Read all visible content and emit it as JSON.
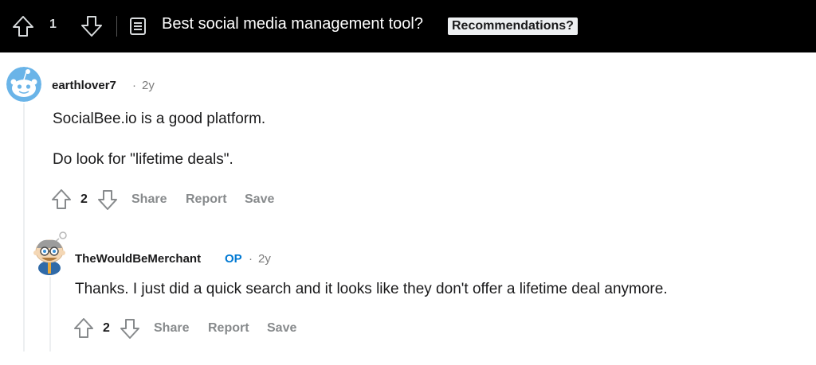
{
  "post": {
    "score": "1",
    "title": "Best social media management tool?",
    "flair": "Recommendations?"
  },
  "comments": [
    {
      "username": "earthlover7",
      "separator": "·",
      "age": "2y",
      "paragraphs": [
        "SocialBee.io is a good platform.",
        "Do look for \"lifetime deals\"."
      ],
      "score": "2",
      "actions": {
        "share": "Share",
        "report": "Report",
        "save": "Save"
      }
    },
    {
      "username": "TheWouldBeMerchant",
      "badge": "OP",
      "separator": "·",
      "age": "2y",
      "paragraphs": [
        "Thanks. I just did a quick search and it looks like they don't offer a lifetime deal anymore."
      ],
      "score": "2",
      "actions": {
        "share": "Share",
        "report": "Report",
        "save": "Save"
      }
    }
  ],
  "icons": {
    "upvote": "arrow-up-outline-icon",
    "downvote": "arrow-down-outline-icon",
    "post": "text-post-icon"
  },
  "colors": {
    "topbar_bg": "#000000",
    "op_badge": "#0079d3",
    "action_text": "#878a8c",
    "meta_text": "#7c7c7c",
    "avatar_blue": "#6ab4e8"
  }
}
